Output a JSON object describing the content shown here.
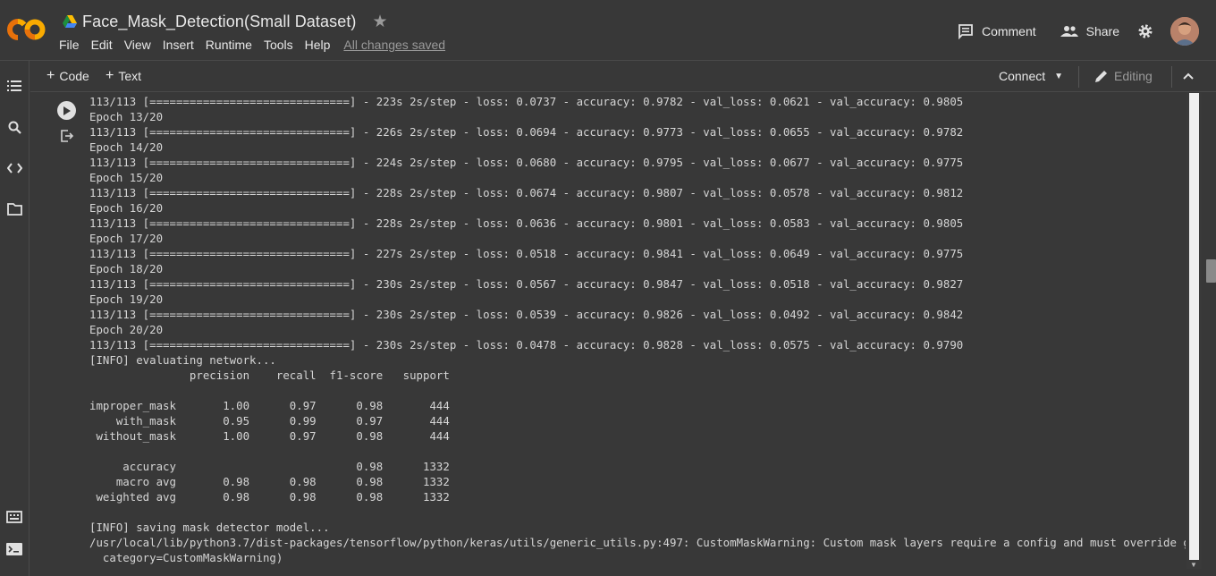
{
  "app": {
    "doc_title": "Face_Mask_Detection(Small Dataset)",
    "menu": [
      "File",
      "Edit",
      "View",
      "Insert",
      "Runtime",
      "Tools",
      "Help"
    ],
    "save_status": "All changes saved",
    "comment_label": "Comment",
    "share_label": "Share",
    "logo_text": "CO"
  },
  "toolbar": {
    "add_code": "Code",
    "add_text": "Text",
    "connect_label": "Connect",
    "editing_label": "Editing"
  },
  "colors": {
    "background": "#383838",
    "logo_orange": "#F9AB00",
    "logo_dark_orange": "#E8710A",
    "text": "#d5d5d5"
  },
  "icons": {
    "rail": [
      "toc-icon",
      "search-icon",
      "code-snippets-icon",
      "files-icon",
      "command-palette-icon",
      "terminal-icon"
    ]
  },
  "output": {
    "lines": [
      "113/113 [==============================] - 223s 2s/step - loss: 0.0737 - accuracy: 0.9782 - val_loss: 0.0621 - val_accuracy: 0.9805",
      "Epoch 13/20",
      "113/113 [==============================] - 226s 2s/step - loss: 0.0694 - accuracy: 0.9773 - val_loss: 0.0655 - val_accuracy: 0.9782",
      "Epoch 14/20",
      "113/113 [==============================] - 224s 2s/step - loss: 0.0680 - accuracy: 0.9795 - val_loss: 0.0677 - val_accuracy: 0.9775",
      "Epoch 15/20",
      "113/113 [==============================] - 228s 2s/step - loss: 0.0674 - accuracy: 0.9807 - val_loss: 0.0578 - val_accuracy: 0.9812",
      "Epoch 16/20",
      "113/113 [==============================] - 228s 2s/step - loss: 0.0636 - accuracy: 0.9801 - val_loss: 0.0583 - val_accuracy: 0.9805",
      "Epoch 17/20",
      "113/113 [==============================] - 227s 2s/step - loss: 0.0518 - accuracy: 0.9841 - val_loss: 0.0649 - val_accuracy: 0.9775",
      "Epoch 18/20",
      "113/113 [==============================] - 230s 2s/step - loss: 0.0567 - accuracy: 0.9847 - val_loss: 0.0518 - val_accuracy: 0.9827",
      "Epoch 19/20",
      "113/113 [==============================] - 230s 2s/step - loss: 0.0539 - accuracy: 0.9826 - val_loss: 0.0492 - val_accuracy: 0.9842",
      "Epoch 20/20",
      "113/113 [==============================] - 230s 2s/step - loss: 0.0478 - accuracy: 0.9828 - val_loss: 0.0575 - val_accuracy: 0.9790",
      "[INFO] evaluating network...",
      "               precision    recall  f1-score   support",
      "",
      "improper_mask       1.00      0.97      0.98       444",
      "    with_mask       0.95      0.99      0.97       444",
      " without_mask       1.00      0.97      0.98       444",
      "",
      "     accuracy                           0.98      1332",
      "    macro avg       0.98      0.98      0.98      1332",
      " weighted avg       0.98      0.98      0.98      1332",
      "",
      "[INFO] saving mask detector model...",
      "/usr/local/lib/python3.7/dist-packages/tensorflow/python/keras/utils/generic_utils.py:497: CustomMaskWarning: Custom mask layers require a config and must override get_config.",
      "  category=CustomMaskWarning)"
    ]
  }
}
